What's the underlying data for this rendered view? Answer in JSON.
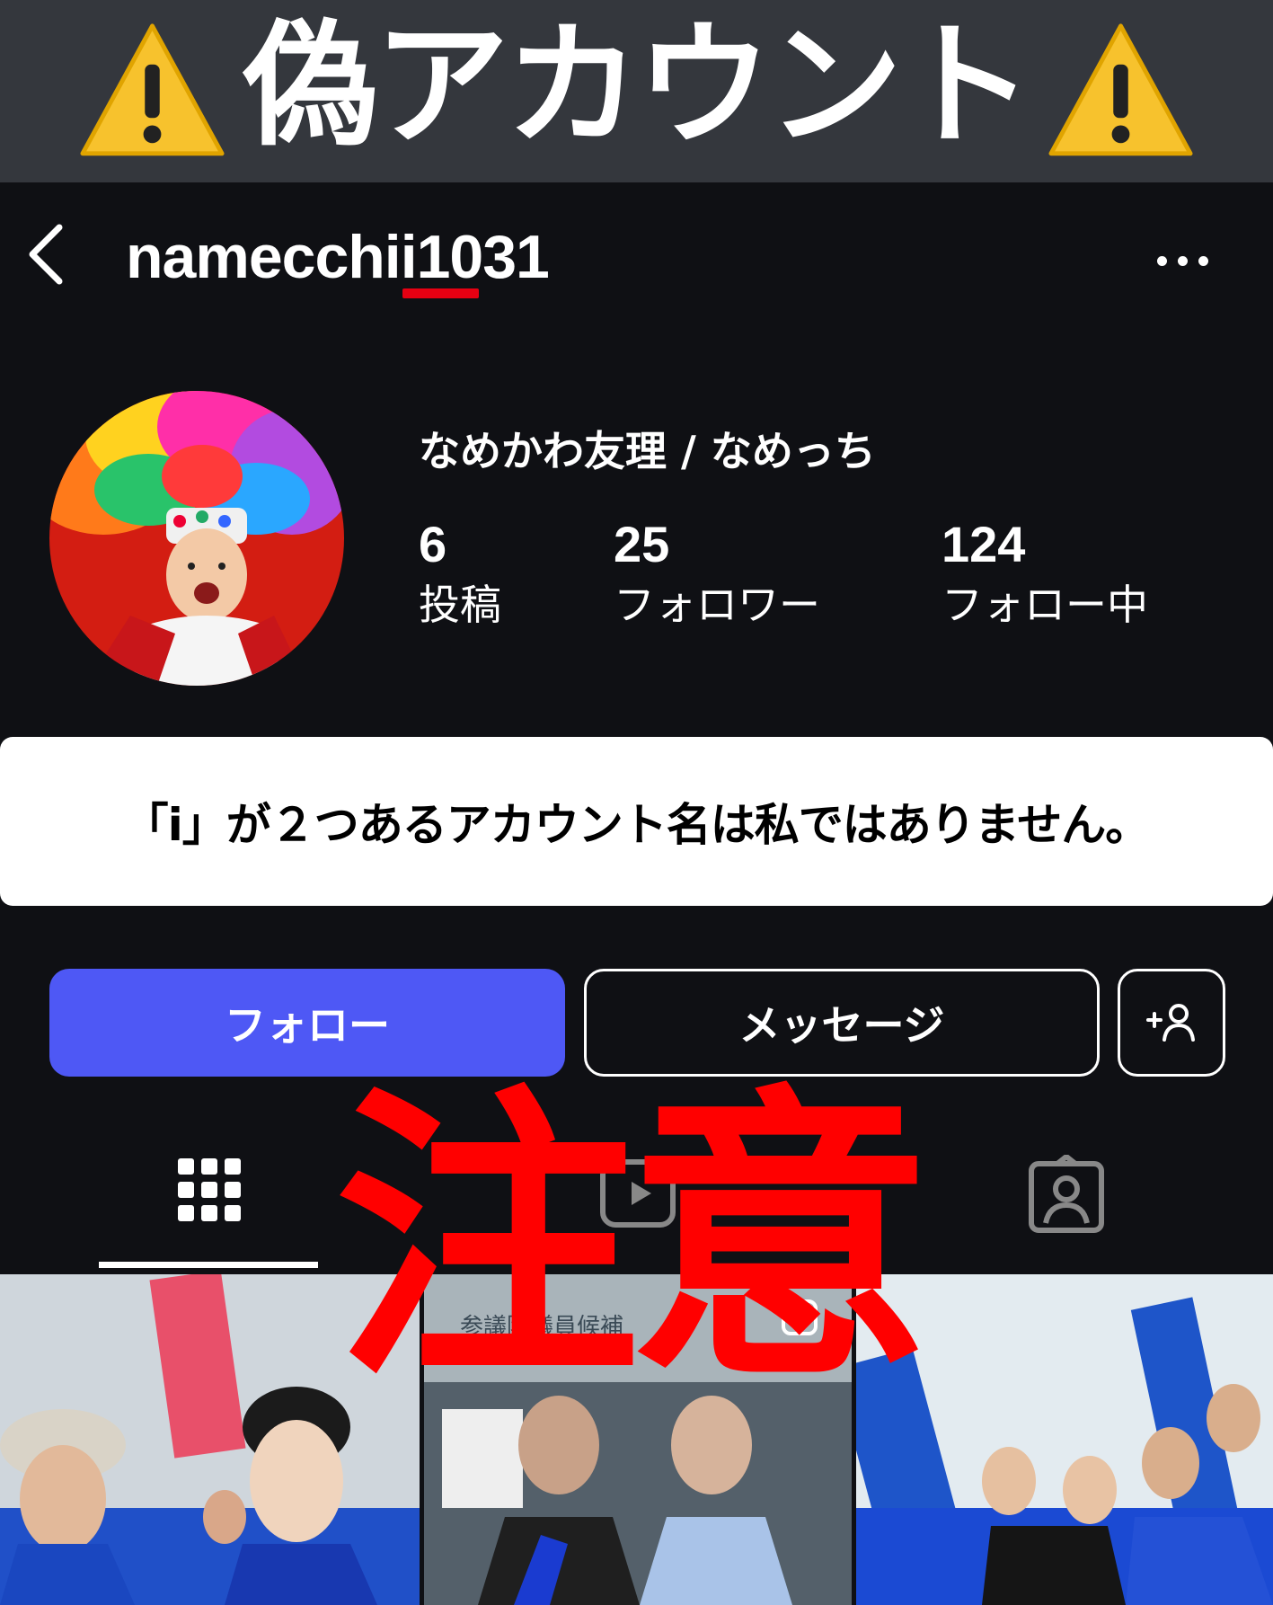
{
  "banner": {
    "title": "偽アカウント",
    "warning_icon": "warning-icon"
  },
  "header": {
    "username": "namecchii1031",
    "back_icon": "chevron-left-icon",
    "more_icon": "more-icon"
  },
  "profile": {
    "display_name": "なめかわ友理 / なめっち",
    "stats": [
      {
        "value": "6",
        "label": "投稿"
      },
      {
        "value": "25",
        "label": "フォロワー"
      },
      {
        "value": "124",
        "label": "フォロー中"
      }
    ]
  },
  "notice": {
    "text": "「i」が２つあるアカウント名は私ではありません。"
  },
  "actions": {
    "follow": "フォロー",
    "message": "メッセージ",
    "add_icon": "add-person-icon"
  },
  "tabs": [
    {
      "icon": "grid-icon",
      "active": true
    },
    {
      "icon": "reels-icon",
      "active": false
    },
    {
      "icon": "tagged-icon",
      "active": false
    }
  ],
  "overlay": {
    "caution": "注意"
  },
  "posts": [
    {
      "caption": ""
    },
    {
      "caption": "参議院議員候補"
    },
    {
      "caption": ""
    }
  ],
  "colors": {
    "banner_bg": "#34373d",
    "app_bg": "#0f1014",
    "follow_button": "#4e58f5",
    "alert_red": "#ff0000",
    "underline_red": "#e60012"
  }
}
